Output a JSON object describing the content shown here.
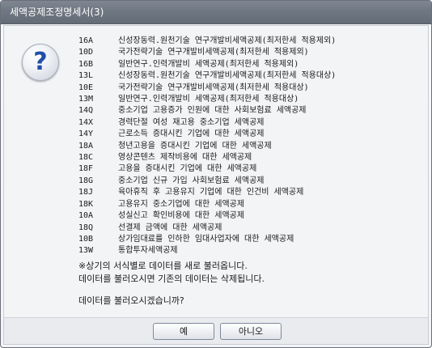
{
  "window": {
    "title": "세액공제조정명세서(3)"
  },
  "icon": {
    "name": "question-icon",
    "glyph": "?"
  },
  "items": [
    {
      "code": "16A",
      "text": "신성장동력.원천기술 연구개발비세액공제(최저한세 적용제외)"
    },
    {
      "code": "10D",
      "text": "국가전략기술 연구개발비세액공제(최저한세 적용제외)"
    },
    {
      "code": "16B",
      "text": "일반연구.인력개발비 세액공제(최저한세 적용제외)"
    },
    {
      "code": "13L",
      "text": "신성장동력.원천기술 연구개발비세액공제(최저한세 적용대상)"
    },
    {
      "code": "10E",
      "text": "국가전략기술 연구개발비세액공제(최저한세 적용대상)"
    },
    {
      "code": "13M",
      "text": "일반연구.인력개발비 세액공제(최저한세 적용대상)"
    },
    {
      "code": "14Q",
      "text": "중소기업 고용증가 인원에 대한 사회보험료 세액공제"
    },
    {
      "code": "14X",
      "text": "경력단절 여성 재고용 중소기업 세액공제"
    },
    {
      "code": "14Y",
      "text": "근로소득 증대시킨 기업에 대한 세액공제"
    },
    {
      "code": "18A",
      "text": "청년고용을 증대시킨 기업에 대한 세액공제"
    },
    {
      "code": "18C",
      "text": "영상콘텐츠 제작비용에 대한 세액공제"
    },
    {
      "code": "18F",
      "text": "고용을 증대시킨 기업에 대한 세액공제"
    },
    {
      "code": "18G",
      "text": "중소기업 신규 가입 사회보험료 세액공제"
    },
    {
      "code": "18J",
      "text": "육아휴직 후 고용유지 기업에 대한 인건비 세액공제"
    },
    {
      "code": "18K",
      "text": "고용유지 중소기업에 대한 세액공제"
    },
    {
      "code": "10A",
      "text": "성실신고 확인비용에 대한 세액공제"
    },
    {
      "code": "18Q",
      "text": "선결제 금액에 대한 세액공제"
    },
    {
      "code": "10B",
      "text": "상가임대료를 인하한 임대사업자에 대한 세액공제"
    },
    {
      "code": "13W",
      "text": "통합투자세액공제"
    }
  ],
  "notes": {
    "line1": "※상기의 서식별로 데이터를 새로 불러옵니다.",
    "line2": "데이터를 불러오시면 기존의 데이터는 삭제됩니다."
  },
  "question": "데이터를 불러오시겠습니까?",
  "buttons": {
    "yes": "예",
    "no": "아니오"
  }
}
